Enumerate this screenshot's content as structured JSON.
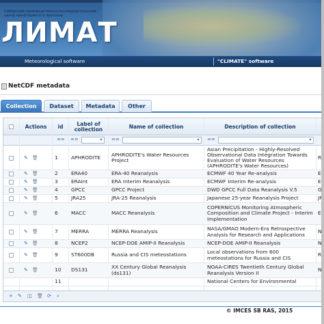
{
  "banner": {
    "org_line1": "Сибирский производственно-исследовательский",
    "org_line2": "центр мониторинга и прогноза",
    "logo_text": "ЛИМАТ"
  },
  "nav": {
    "left_label": "Meteorological software",
    "right_label": "\"CLIMATE\" software"
  },
  "panel": {
    "title": "NetCDF metadata"
  },
  "tabs": [
    {
      "label": "Collection",
      "active": true
    },
    {
      "label": "Dataset",
      "active": false
    },
    {
      "label": "Metadata",
      "active": false
    },
    {
      "label": "Other",
      "active": false
    }
  ],
  "grid": {
    "headers": {
      "actions": "Actions",
      "id": "id",
      "label": "Label of collection",
      "name": "Name of collection",
      "description": "Description of collection"
    },
    "filter": {
      "eq_id": "==",
      "eq_label": "==",
      "eq_name": "==",
      "eq_desc": "=="
    },
    "rows": [
      {
        "id": "1",
        "label": "APHRODITE",
        "name": "APHRODITE's Water Resources Project",
        "description": "Asian Precipitation - Highly-Resolved Observational Data Integration Towards Evaluation of Water Resources (APHRODITE's Water Resources)",
        "extra": "RI"
      },
      {
        "id": "2",
        "label": "ERA40",
        "name": "ERA-40 Reanalysis",
        "description": "ECMWF 40 Year Re-analysis",
        "extra": "EC"
      },
      {
        "id": "3",
        "label": "ERAInt",
        "name": "ERA Interim Reanalysis",
        "description": "ECMWF Interim Re-analysis",
        "extra": "EC"
      },
      {
        "id": "4",
        "label": "GPCC",
        "name": "GPCC Project",
        "description": "DWD GPCC Full Data Reanalysis V.5",
        "extra": "GI"
      },
      {
        "id": "5",
        "label": "JRA25",
        "name": "JRA-25 Reanalysis",
        "description": "Japanese 25-year Reanalysis Project",
        "extra": "JM"
      },
      {
        "id": "6",
        "label": "MACC",
        "name": "MACC Reanalysis",
        "description": "COPERNICUS Monitoring Atmospheric Composition and Climate Project - Interim Implementation",
        "extra": "EC"
      },
      {
        "id": "7",
        "label": "MERRA",
        "name": "MERRA Reanalysis",
        "description": "NASA/GMAO Modern-Era Retrospective Analysis for Research and Applications",
        "extra": "N"
      },
      {
        "id": "8",
        "label": "NCEP2",
        "name": "NCEP-DOE AMIP-II Reanalysis",
        "description": "NCEP-DOE AMIP-II Reanalysis",
        "extra": "N"
      },
      {
        "id": "9",
        "label": "ST600DB",
        "name": "Russia and CIS meteostations",
        "description": "Local observations from 600 meteostations for Russia and CIS",
        "extra": "RI"
      },
      {
        "id": "10",
        "label": "DS131",
        "name": "XX Century Global Reanalysis (ds131)",
        "description": "NOAA-CIRES Twentieth Century Global Reanalysis Version II",
        "extra": "N"
      },
      {
        "id": "11",
        "label": "",
        "name": "",
        "description": "National Centers for Environmental",
        "extra": ""
      }
    ]
  },
  "toolbar": {
    "add_icon": "plus-icon",
    "edit_icon": "pencil-icon",
    "view_icon": "view-icon",
    "delete_icon": "trash-icon",
    "refresh_icon": "refresh-icon",
    "search_icon": "search-icon"
  },
  "footer": {
    "copyright": "© IMCES SB RAS, 2015"
  },
  "colors": {
    "accent": "#3d7ec4",
    "header_dark": "#1f4a7e",
    "tab_active": "#3775b8"
  }
}
